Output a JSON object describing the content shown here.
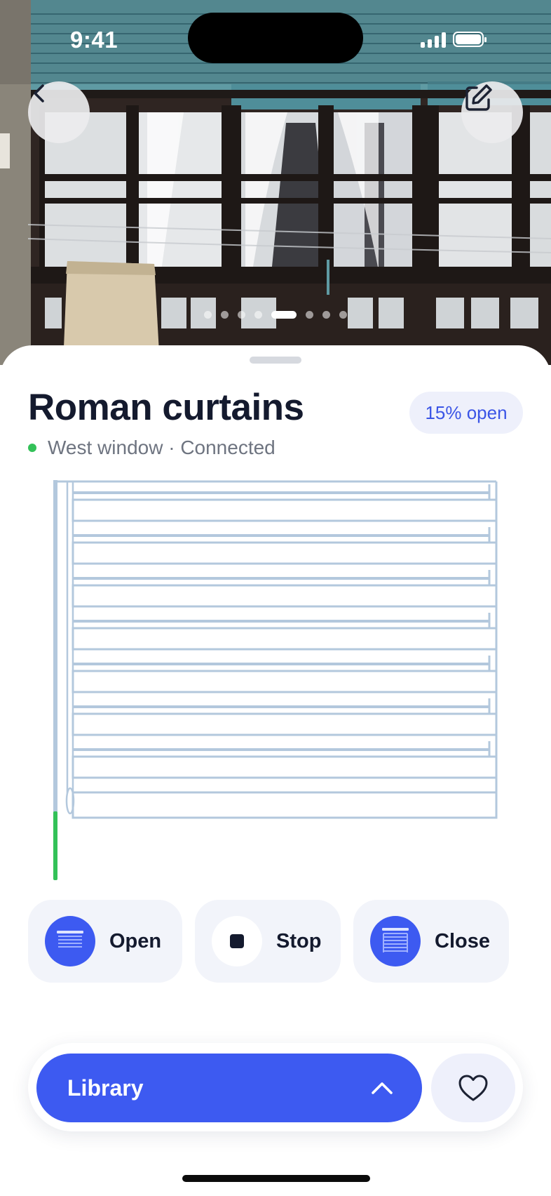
{
  "status_bar": {
    "time": "9:41"
  },
  "hero": {
    "carousel_total": 8,
    "carousel_active_index": 4
  },
  "device": {
    "name": "Roman curtains",
    "location_status": "West window · Connected",
    "open_badge": "15% open",
    "open_percent": 15
  },
  "controls": {
    "open_label": "Open",
    "stop_label": "Stop",
    "close_label": "Close"
  },
  "bottom_bar": {
    "library_label": "Library"
  },
  "colors": {
    "accent": "#3d5af1",
    "status_connected": "#33c158",
    "badge_bg": "#eef0fb",
    "blind_stroke": "#b3c8dd"
  }
}
